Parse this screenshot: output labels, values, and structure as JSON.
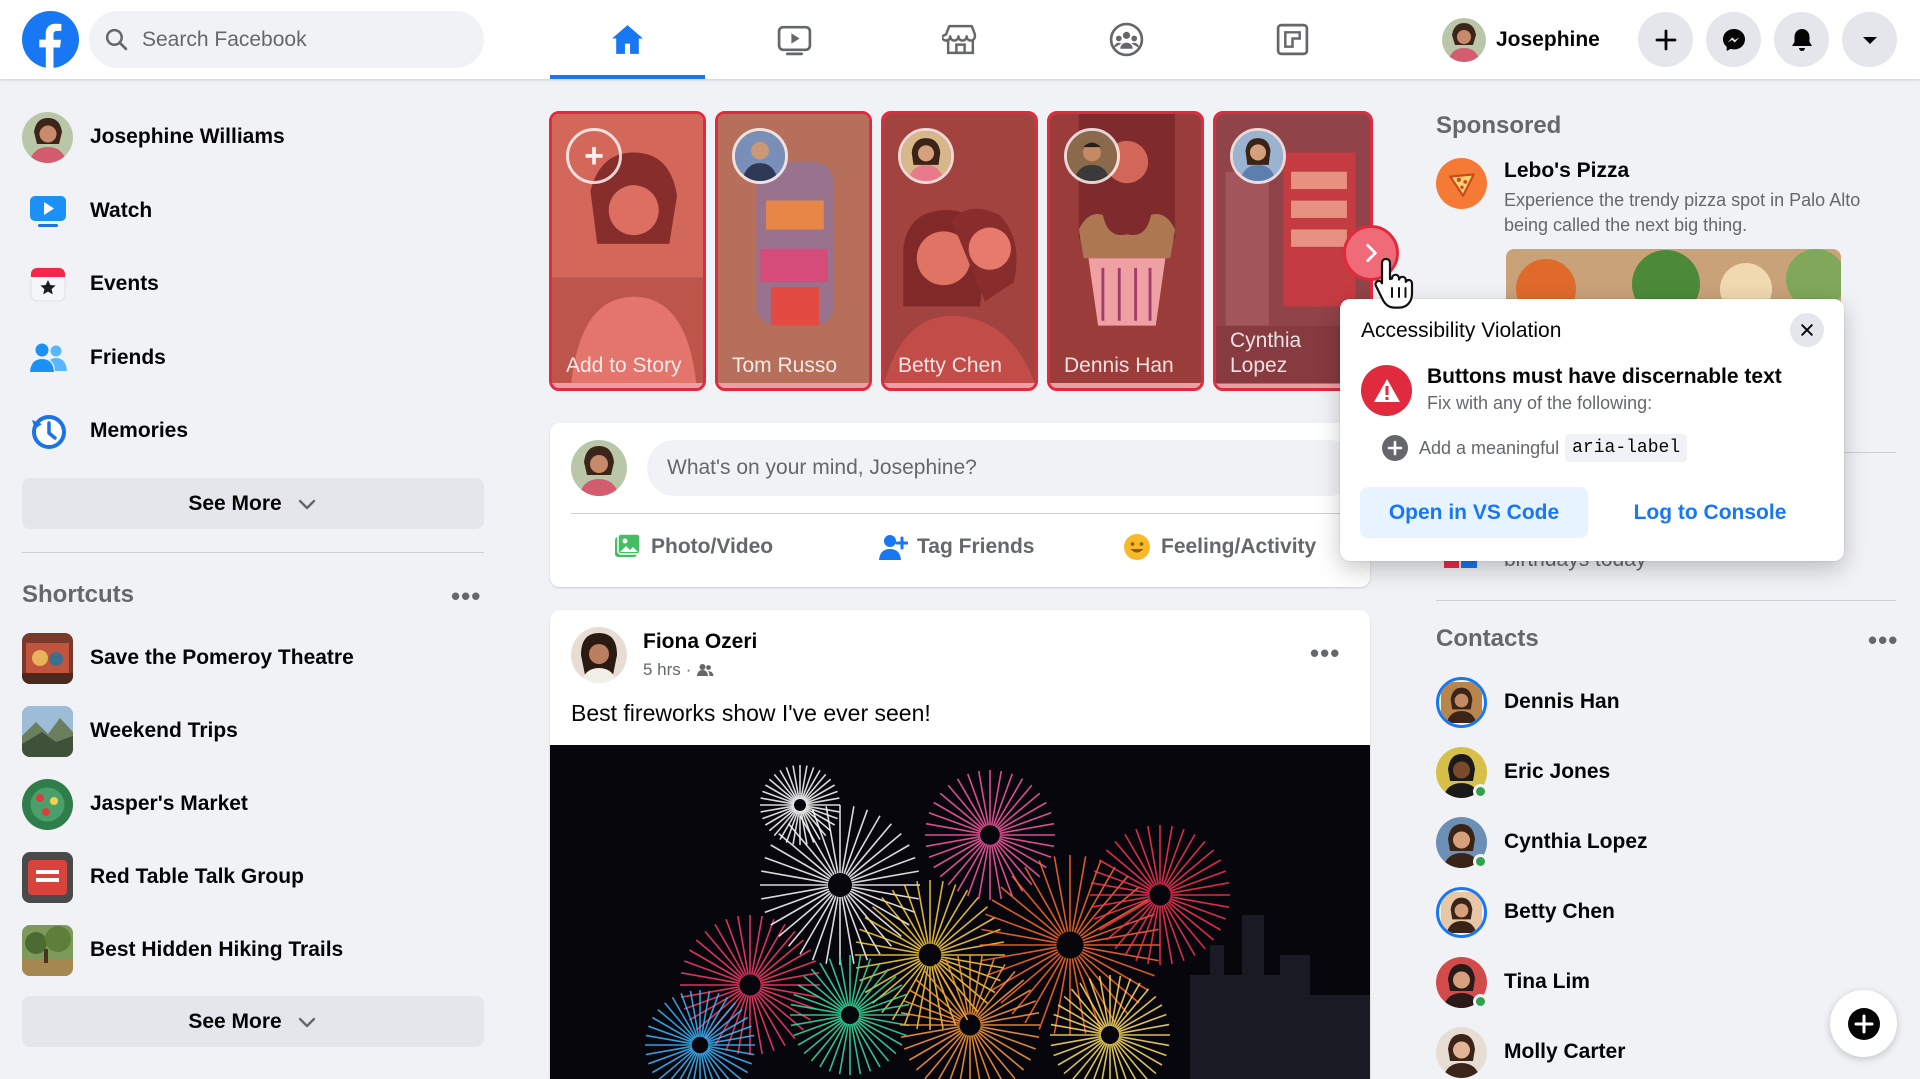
{
  "search": {
    "placeholder": "Search Facebook"
  },
  "nav": {
    "tabs": [
      "home",
      "watch",
      "marketplace",
      "groups",
      "gaming"
    ],
    "active": "home"
  },
  "profile": {
    "name": "Josephine"
  },
  "left": {
    "user": "Josephine Williams",
    "items": [
      {
        "label": "Watch",
        "icon": "watch-icon"
      },
      {
        "label": "Events",
        "icon": "events-icon"
      },
      {
        "label": "Friends",
        "icon": "friends-icon"
      },
      {
        "label": "Memories",
        "icon": "memories-icon"
      }
    ],
    "see_more": "See More",
    "shortcuts_title": "Shortcuts",
    "shortcuts": [
      {
        "label": "Save the Pomeroy Theatre"
      },
      {
        "label": "Weekend Trips"
      },
      {
        "label": "Jasper's Market"
      },
      {
        "label": "Red Table Talk Group"
      },
      {
        "label": "Best Hidden Hiking Trails"
      }
    ],
    "see_more_2": "See More"
  },
  "stories": [
    {
      "name": "Add to Story"
    },
    {
      "name": "Tom Russo"
    },
    {
      "name": "Betty Chen"
    },
    {
      "name": "Dennis Han"
    },
    {
      "name": "Cynthia Lopez"
    }
  ],
  "composer": {
    "placeholder": "What's on your mind, Josephine?",
    "actions": [
      "Photo/Video",
      "Tag Friends",
      "Feeling/Activity"
    ]
  },
  "post": {
    "author": "Fiona Ozeri",
    "time": "5 hrs",
    "text": "Best fireworks show I've ever seen!"
  },
  "sponsored": {
    "title": "Sponsored",
    "advertiser": "Lebo's Pizza",
    "description": "Experience the trendy pizza spot in Palo Alto being called the next big thing."
  },
  "birthdays_fragment": "birthdays today",
  "contacts": {
    "title": "Contacts",
    "list": [
      {
        "name": "Dennis Han",
        "online": false,
        "story": true
      },
      {
        "name": "Eric Jones",
        "online": true,
        "story": false
      },
      {
        "name": "Cynthia Lopez",
        "online": true,
        "story": false
      },
      {
        "name": "Betty Chen",
        "online": false,
        "story": true
      },
      {
        "name": "Tina Lim",
        "online": true,
        "story": false
      },
      {
        "name": "Molly Carter",
        "online": false,
        "story": false
      }
    ]
  },
  "popup": {
    "title": "Accessibility Violation",
    "heading": "Buttons must have discernable text",
    "subheading": "Fix with any of the following:",
    "fix_prefix": "Add a meaningful",
    "fix_code": "aria-label",
    "primary_button": "Open in VS Code",
    "secondary_button": "Log to Console"
  },
  "colors": {
    "brand": "#1877f2",
    "violation": "#e02a3d",
    "online": "#31a24c"
  }
}
